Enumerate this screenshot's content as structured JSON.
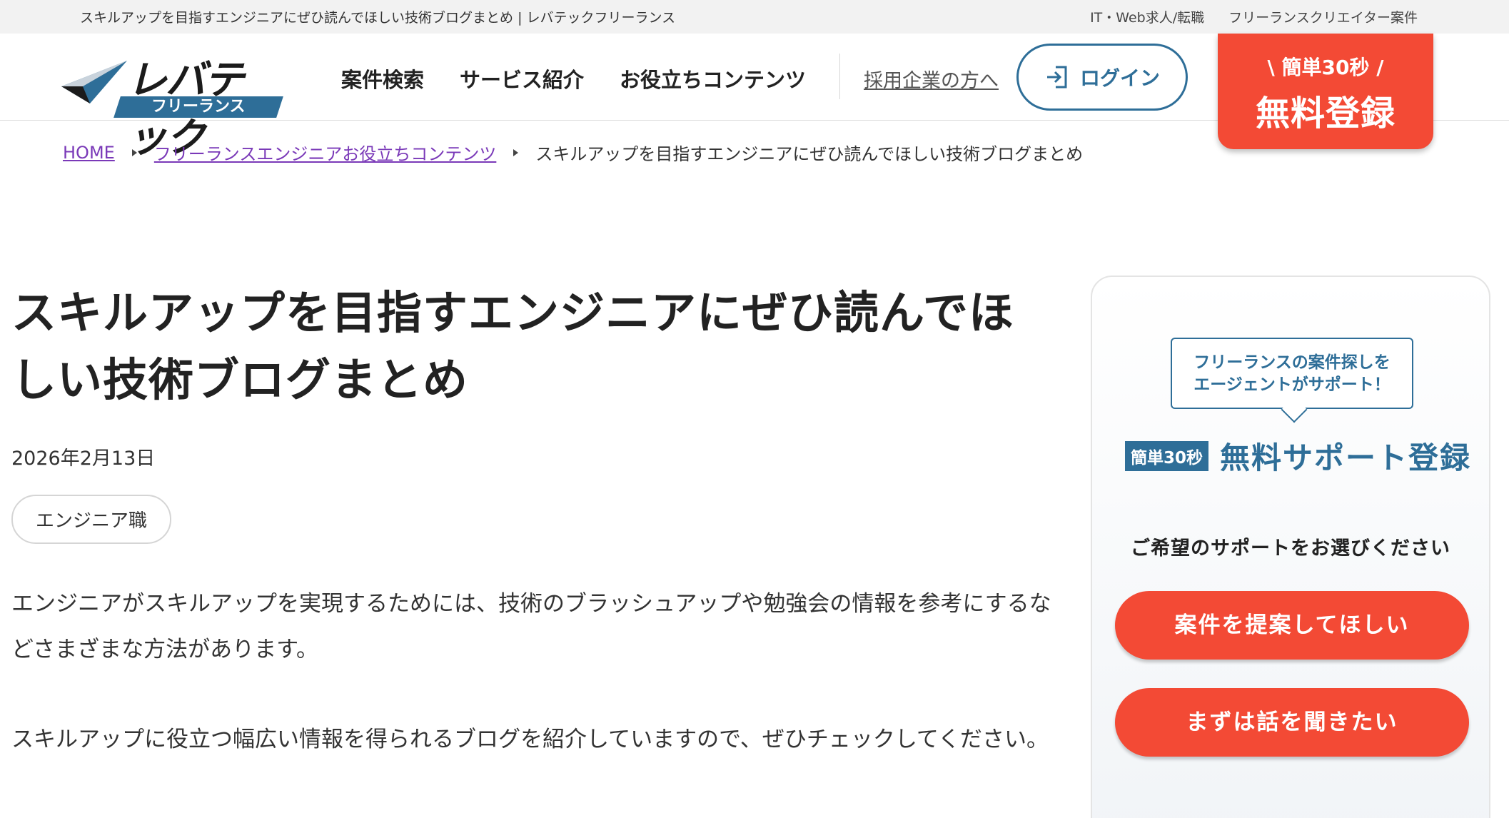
{
  "topbar": {
    "site_description": "スキルアップを目指すエンジニアにぜひ読んでほしい技術ブログまとめ | レバテックフリーランス",
    "links": [
      "IT・Web求人/転職",
      "フリーランスクリエイター案件"
    ]
  },
  "header": {
    "logo_main": "レバテック",
    "logo_sub": "フリーランス",
    "nav": [
      "案件検索",
      "サービス紹介",
      "お役立ちコンテンツ"
    ],
    "employer_link": "採用企業の方へ",
    "login_label": "ログイン",
    "register_small": "\\ 簡単30秒 /",
    "register_big": "無料登録"
  },
  "breadcrumb": {
    "items": [
      "HOME",
      "フリーランスエンジニアお役立ちコンテンツ"
    ],
    "current": "スキルアップを目指すエンジニアにぜひ読んでほしい技術ブログまとめ"
  },
  "article": {
    "title": "スキルアップを目指すエンジニアにぜひ読んでほしい技術ブログまとめ",
    "date": "2026年2月13日",
    "tag": "エンジニア職",
    "paragraphs": [
      "エンジニアがスキルアップを実現するためには、技術のブラッシュアップや勉強会の情報を参考にするなどさまざまな方法があります。",
      "スキルアップに役立つ幅広い情報を得られるブログを紹介していますので、ぜひチェックしてください。"
    ]
  },
  "sidebar": {
    "speech_line1": "フリーランスの案件探しを",
    "speech_line2": "エージェントがサポート！",
    "badge": "簡単30秒",
    "title": "無料サポート登録",
    "choose": "ご希望のサポートをお選びください",
    "cta1": "案件を提案してほしい",
    "cta2": "まずは話を聞きたい"
  },
  "colors": {
    "brand_blue": "#2e6e98",
    "accent_red": "#f34a35",
    "link_purple": "#7a39b8"
  },
  "icons": [
    "logo-mark-icon",
    "login-icon",
    "breadcrumb-arrow-icon"
  ]
}
